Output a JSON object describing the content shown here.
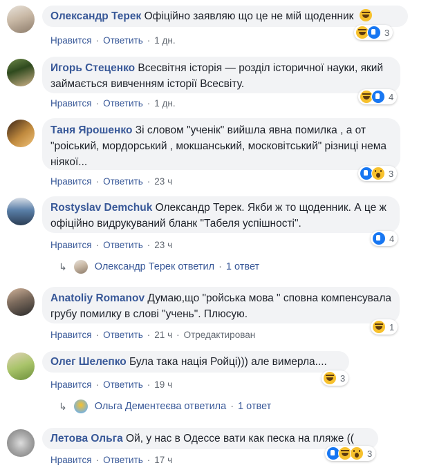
{
  "actions": {
    "like": "Нравится",
    "reply": "Ответить"
  },
  "comments": [
    {
      "author": "Олександр Терек",
      "text": "Офіційно заявляю що це не мій щоденник",
      "time": "1 дн.",
      "reactions": [
        "haha",
        "like"
      ],
      "count": "3",
      "avatar_colors": [
        "#8c7b6a",
        "#c9b9a6",
        "#e8e2da"
      ]
    },
    {
      "author": "Игорь Стеценко",
      "text": "Всесвітня історія — розділ історичної науки, який займається вивченням історії Всесвіту.",
      "time": "1 дн.",
      "reactions": [
        "haha",
        "like"
      ],
      "count": "4",
      "avatar_colors": [
        "#2f4a1e",
        "#6f8a4a",
        "#d0b38a"
      ]
    },
    {
      "author": "Таня Ярошенко",
      "text": "Зі словом \"ученік\" вийшла явна помилка , а от \"роіський, мордорський , мокшанський, московітський\" різниці нема ніякої...",
      "time": "23 ч",
      "reactions": [
        "like",
        "wow"
      ],
      "count": "3",
      "avatar_colors": [
        "#3a2416",
        "#c08a3e",
        "#f0c27a"
      ]
    },
    {
      "author": "Rostyslav Demchuk",
      "text": "Олександр Терек. Якби ж то щоденник. А це ж офіційно видрукуваний бланк \"Табеля успішності\".",
      "time": "23 ч",
      "reactions": [
        "like"
      ],
      "count": "4",
      "avatar_colors": [
        "#5a7fa8",
        "#2b3e55",
        "#d6dde6"
      ],
      "reply": {
        "text": "Олександр Терек ответил",
        "count": "1 ответ"
      }
    },
    {
      "author": "Anatoliy Romanov",
      "text": "Думаю,що \"ройська мова \" сповна компенсувала грубу помилку в слові \"учень\". Плюсую.",
      "time": "21 ч",
      "edited": "Отредактирован",
      "reactions": [
        "haha"
      ],
      "count": "1",
      "avatar_colors": [
        "#2a2a2a",
        "#7b6a5c",
        "#d1b39a"
      ]
    },
    {
      "author": "Олег Шелепко",
      "text": "Була така нація Ройці))) але вимерла....",
      "time": "19 ч",
      "reactions": [
        "haha"
      ],
      "count": "3",
      "avatar_colors": [
        "#6d8f3a",
        "#a9c46a",
        "#e0d2b8"
      ],
      "reply": {
        "text": "Ольга Дементеєва ответила",
        "count": "1 ответ"
      }
    },
    {
      "author": "Летова Ольга",
      "text": "Ой, у нас в Одессе вати как песка на пляже ((",
      "time": "17 ч",
      "reactions": [
        "like",
        "haha",
        "wow"
      ],
      "count": "3",
      "avatar_colors": [
        "#777777",
        "#aaaaaa",
        "#dddddd"
      ]
    }
  ]
}
